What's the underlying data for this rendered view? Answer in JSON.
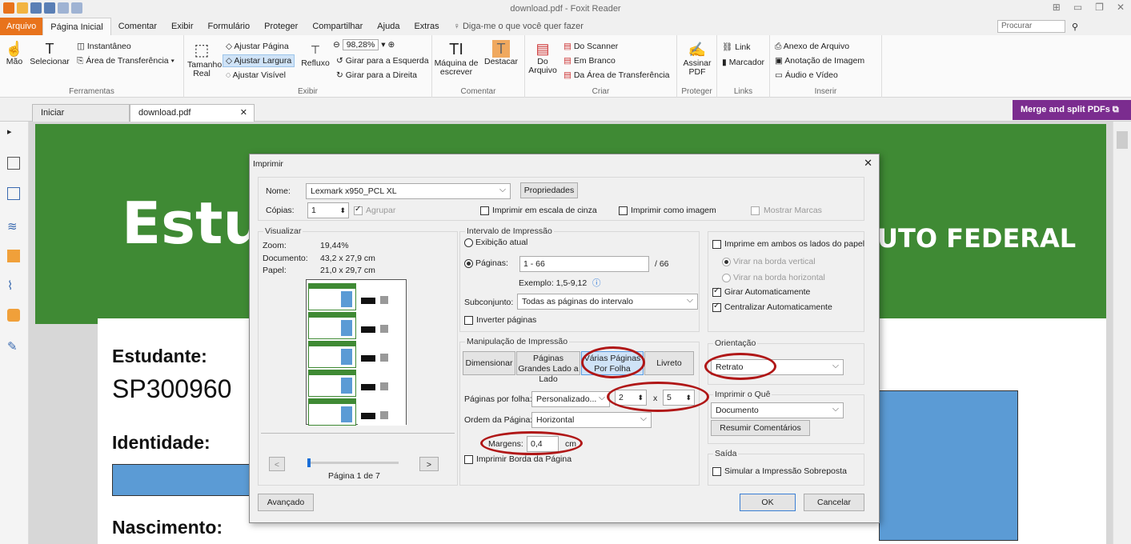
{
  "window": {
    "title": "download.pdf - Foxit Reader"
  },
  "menu": {
    "file": "Arquivo",
    "tabs": [
      "Página Inicial",
      "Comentar",
      "Exibir",
      "Formulário",
      "Proteger",
      "Compartilhar",
      "Ajuda",
      "Extras"
    ],
    "tell_me": "Diga-me o que você quer fazer",
    "search_placeholder": "Procurar"
  },
  "ribbon": {
    "tools": {
      "hand": "Mão",
      "select": "Selecionar",
      "snapshot": "Instantâneo",
      "clipboard": "Área de Transferência",
      "label": "Ferramentas"
    },
    "view": {
      "actual_size": "Tamanho Real",
      "fit_page": "Ajustar Página",
      "fit_width": "Ajustar Largura",
      "fit_visible": "Ajustar Visível",
      "reflow": "Refluxo",
      "zoom": "98,28%",
      "rotate_left": "Girar para a Esquerda",
      "rotate_right": "Girar para a Direita",
      "label": "Exibir"
    },
    "comment": {
      "typewriter": "Máquina de escrever",
      "highlight": "Destacar",
      "label": "Comentar"
    },
    "create": {
      "from_file": "Do Arquivo",
      "from_scanner": "Do Scanner",
      "blank": "Em Branco",
      "from_clipboard": "Da Área de Transferência",
      "label": "Criar"
    },
    "protect": {
      "sign": "Assinar PDF",
      "label": "Proteger"
    },
    "links": {
      "link": "Link",
      "bookmark": "Marcador",
      "label": "Links"
    },
    "insert": {
      "attachment": "Anexo de Arquivo",
      "image": "Anotação de Imagem",
      "audio_video": "Áudio e Vídeo",
      "label": "Inserir"
    }
  },
  "doc_tabs": [
    "Iniciar",
    "download.pdf"
  ],
  "merge_button": "Merge and split PDFs",
  "document": {
    "title_fragment": "Estu",
    "header_right": "UTO FEDERAL",
    "student_label": "Estudante:",
    "student_value": "SP300960",
    "id_label": "Identidade:",
    "birth_label": "Nascimento:"
  },
  "dialog": {
    "title": "Imprimir",
    "printer_label": "Nome:",
    "printer": "Lexmark x950_PCL XL",
    "properties": "Propriedades",
    "copies_label": "Cópias:",
    "copies": "1",
    "collate": "Agrupar",
    "grayscale": "Imprimir em escala de cinza",
    "as_image": "Imprimir como imagem",
    "show_marks": "Mostrar Marcas",
    "preview": {
      "legend": "Visualizar",
      "zoom_label": "Zoom:",
      "zoom": "19,44%",
      "doc_label": "Documento:",
      "doc": "43,2 x 27,9 cm",
      "paper_label": "Papel:",
      "paper": "21,0 x 29,7 cm",
      "page_indicator": "Página 1 de 7",
      "prev": "<",
      "next": ">"
    },
    "range": {
      "legend": "Intervalo de Impressão",
      "current": "Exibição atual",
      "pages": "Páginas:",
      "pages_value": "1 - 66",
      "total": "/ 66",
      "example": "Exemplo: 1,5-9,12",
      "subset_label": "Subconjunto:",
      "subset": "Todas as páginas do intervalo",
      "reverse": "Inverter páginas"
    },
    "handling": {
      "legend": "Manipulação de Impressão",
      "tabs": [
        "Dimensionar",
        "Páginas Grandes Lado a Lado",
        "Várias Páginas Por Folha",
        "Livreto"
      ],
      "pps_label": "Páginas por folha:",
      "pps": "Personalizado...",
      "cols": "2",
      "x": "x",
      "rows": "5",
      "order_label": "Ordem da Página:",
      "order": "Horizontal",
      "margins_label": "Margens:",
      "margins": "0,4",
      "margins_unit": "cm",
      "border": "Imprimir Borda da Página"
    },
    "duplex": {
      "both_sides": "Imprime em ambos os lados do papel",
      "flip_long": "Virar na borda vertical",
      "flip_short": "Virar na borda horizontal",
      "auto_rotate": "Girar Automaticamente",
      "auto_center": "Centralizar Automaticamente"
    },
    "orientation": {
      "legend": "Orientação",
      "value": "Retrato"
    },
    "what": {
      "legend": "Imprimir o Quê",
      "value": "Documento",
      "summarize": "Resumir Comentários"
    },
    "output": {
      "legend": "Saída",
      "simulate": "Simular a Impressão Sobreposta"
    },
    "advanced": "Avançado",
    "ok": "OK",
    "cancel": "Cancelar"
  },
  "colors": {
    "accent": "#e8731c",
    "green": "#3f8a34",
    "merge": "#7b2c8f",
    "highlight": "#b01717",
    "blue_box": "#5b9bd5"
  }
}
